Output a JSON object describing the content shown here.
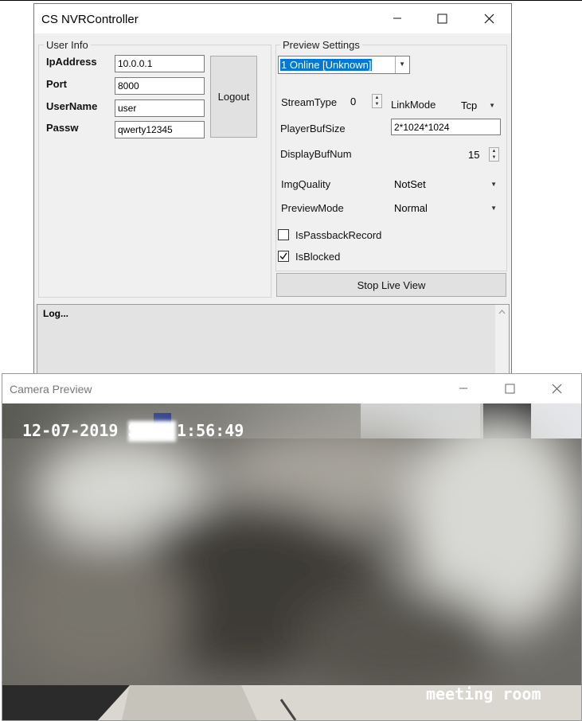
{
  "main_window": {
    "title": "CS NVRController",
    "user_info": {
      "group_label": "User Info",
      "ip_label": "IpAddress",
      "ip_value": "10.0.0.1",
      "port_label": "Port",
      "port_value": "8000",
      "username_label": "UserName",
      "username_value": "user",
      "password_label": "Passw",
      "password_value": "qwerty12345",
      "logout_label": "Logout"
    },
    "preview_settings": {
      "group_label": "Preview Settings",
      "channel_selected": "1 Online [Unknown]",
      "stream_type_label": "StreamType",
      "stream_type_value": "0",
      "link_mode_label": "LinkMode",
      "link_mode_value": "Tcp",
      "player_buf_label": "PlayerBufSize",
      "player_buf_value": "2*1024*1024",
      "display_buf_label": "DisplayBufNum",
      "display_buf_value": "15",
      "img_quality_label": "ImgQuality",
      "img_quality_value": "NotSet",
      "preview_mode_label": "PreviewMode",
      "preview_mode_value": "Normal",
      "passback_label": "IsPassbackRecord",
      "passback_checked": false,
      "blocked_label": "IsBlocked",
      "blocked_checked": true,
      "stop_label": "Stop Live View"
    },
    "log": {
      "text": "Log..."
    }
  },
  "preview_window": {
    "title": "Camera Preview",
    "timestamp_left": "12-07-2019 S",
    "timestamp_right": "1:56:49",
    "camera_name": "meeting room"
  },
  "icons": {
    "minimize": "minimize-icon",
    "maximize": "maximize-icon",
    "close": "close-icon",
    "checkmark": "checkmark-icon",
    "dropdown": "chevron-down-icon"
  }
}
